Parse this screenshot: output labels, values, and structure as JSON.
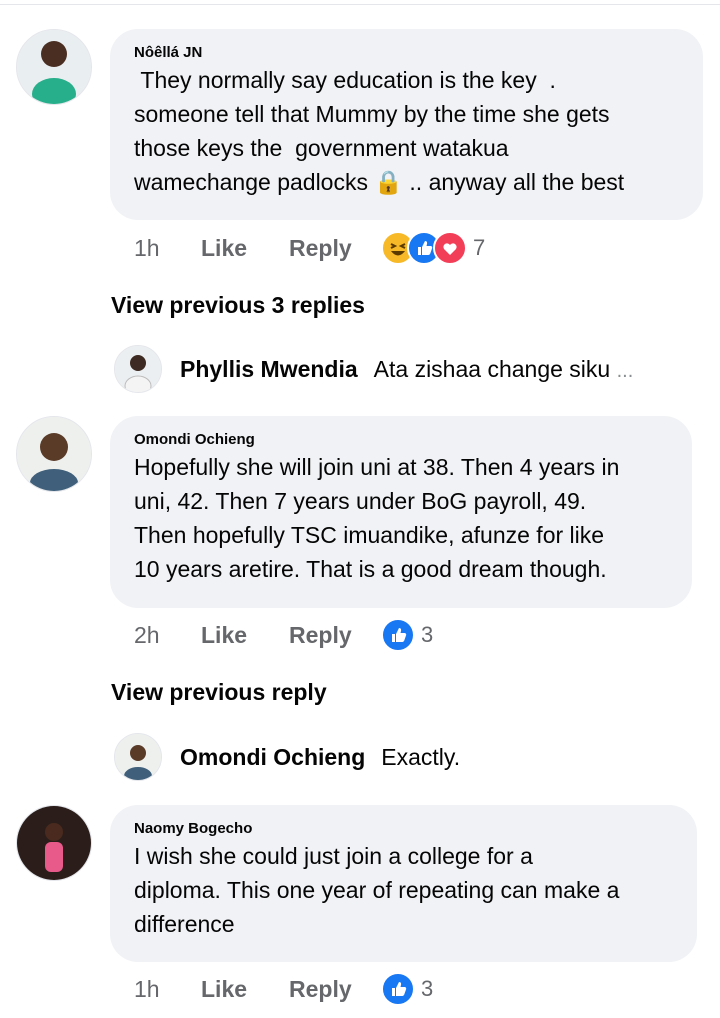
{
  "comments": [
    {
      "author": "Nôêllá JN",
      "text": " They normally say education is the key  .\nsomeone tell that Mummy by the time she gets\nthose keys the  government watakua\nwamechange padlocks",
      "text_tail": " .. anyway all the best",
      "time": "1h",
      "like_label": "Like",
      "reply_label": "Reply",
      "reaction_icons": [
        "haha-reaction-icon",
        "like-reaction-icon",
        "love-reaction-icon"
      ],
      "reaction_count": "7"
    },
    {
      "author": "Omondi Ochieng",
      "text": "Hopefully she will join uni at 38. Then 4 years in\nuni, 42. Then 7 years under BoG payroll, 49.\nThen hopefully TSC imuandike, afunze for like\n10 years aretire. That is a good dream though.",
      "time": "2h",
      "like_label": "Like",
      "reply_label": "Reply",
      "reaction_icons": [
        "like-reaction-icon"
      ],
      "reaction_count": "3"
    },
    {
      "author": "Naomy Bogecho",
      "text": "I wish she could just join a college for a\ndiploma. This one year of repeating can make a\ndifference",
      "time": "1h",
      "like_label": "Like",
      "reply_label": "Reply",
      "reaction_icons": [
        "like-reaction-icon"
      ],
      "reaction_count": "3"
    }
  ],
  "view_previous": [
    {
      "label": "View previous 3 replies"
    },
    {
      "label": "View previous reply"
    }
  ],
  "replies": [
    {
      "author": "Phyllis Mwendia",
      "text": "Ata zishaa change siku",
      "ellipsis": "..."
    },
    {
      "author": "Omondi Ochieng",
      "text": "Exactly."
    }
  ],
  "colors": {
    "bubble": "#f0f2f5",
    "meta_text": "#65676b",
    "like_blue": "#1877f2",
    "haha_yellow": "#f7b928",
    "love_red": "#f33e58"
  }
}
